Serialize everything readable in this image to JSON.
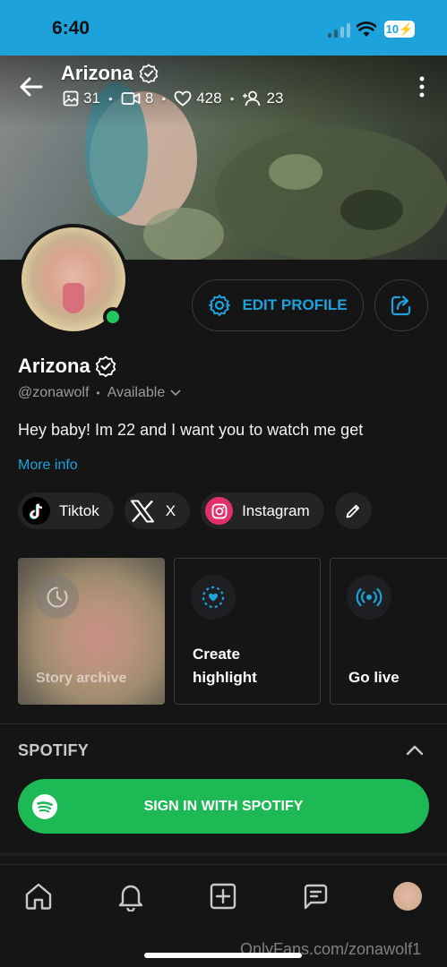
{
  "status": {
    "time": "6:40",
    "battery": "10"
  },
  "header": {
    "name": "Arizona",
    "stats": [
      {
        "icon": "photo-icon",
        "value": "31"
      },
      {
        "icon": "video-icon",
        "value": "8"
      },
      {
        "icon": "heart-icon",
        "value": "428"
      },
      {
        "icon": "fans-icon",
        "value": "23"
      }
    ]
  },
  "profile": {
    "name": "Arizona",
    "handle": "@zonawolf",
    "availability": "Available",
    "bio": "Hey baby! Im 22 and I want you to watch me get",
    "more_info": "More info",
    "edit_label": "EDIT PROFILE"
  },
  "socials": [
    {
      "label": "Tiktok",
      "icon": "tiktok-icon"
    },
    {
      "label": "X",
      "icon": "x-icon"
    },
    {
      "label": "Instagram",
      "icon": "instagram-icon"
    }
  ],
  "stories": {
    "archive": "Story archive",
    "highlight": "Create highlight",
    "live": "Go live"
  },
  "spotify": {
    "title": "SPOTIFY",
    "button": "SIGN IN WITH SPOTIFY"
  },
  "watermark": "OnlyFans.com/zonawolf1",
  "colors": {
    "accent": "#1ea2dc",
    "spotify": "#1db954",
    "online": "#22c55e",
    "background": "#151516"
  }
}
